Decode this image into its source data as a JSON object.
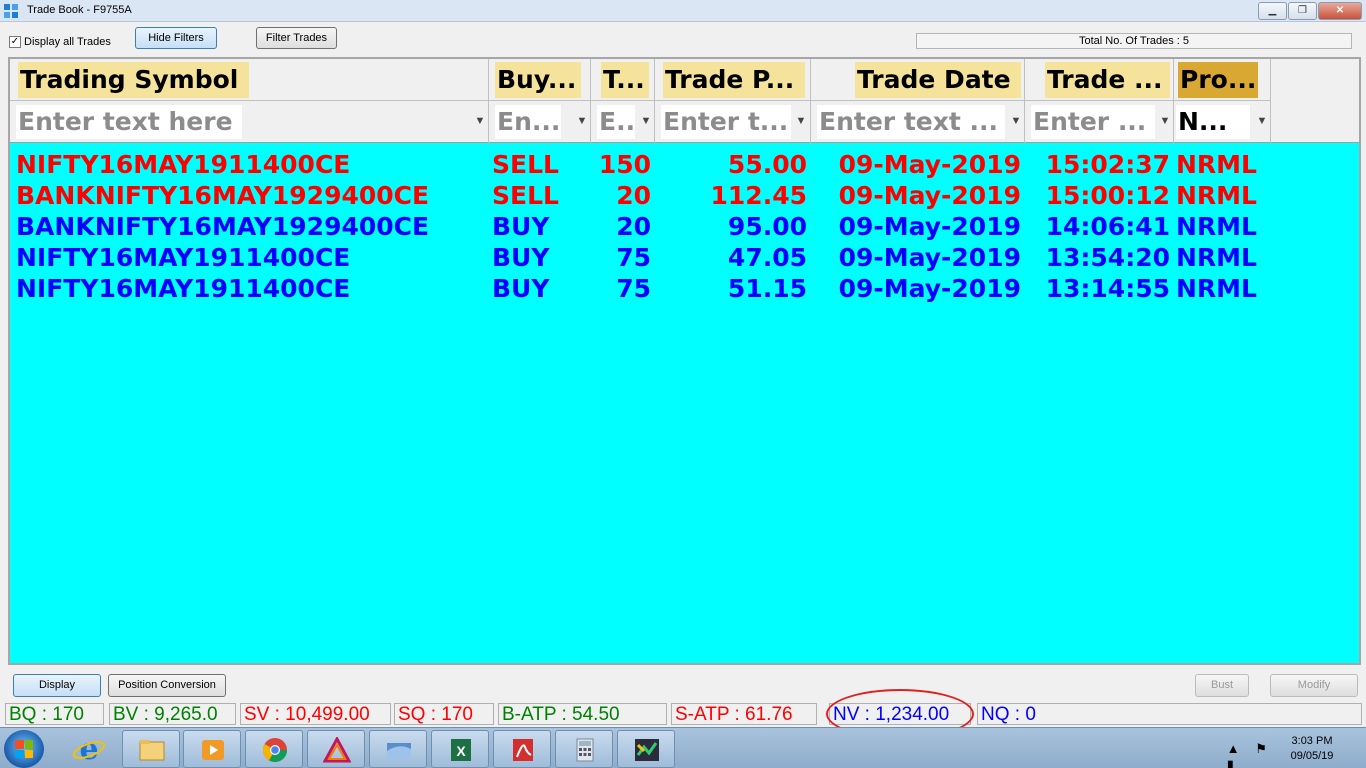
{
  "window": {
    "title": "Trade Book - F9755A",
    "min": "▁",
    "max": "❐",
    "close": "✕"
  },
  "toolbar": {
    "display_all_label": "Display all Trades",
    "display_all_checked": true,
    "hide_filters": "Hide Filters",
    "filter_trades": "Filter Trades",
    "total_trades": "Total No. Of Trades : 5"
  },
  "columns": [
    {
      "header": "Trading Symbol",
      "filter": "Enter text here"
    },
    {
      "header": "Buy...",
      "filter": "En..."
    },
    {
      "header": "T...",
      "filter": "E.."
    },
    {
      "header": "Trade P...",
      "filter": "Enter t..."
    },
    {
      "header": "Trade Date",
      "filter": "Enter text ..."
    },
    {
      "header": "Trade ...",
      "filter": "Enter ..."
    },
    {
      "header": "Pro...",
      "filter": "N..."
    }
  ],
  "trades": [
    {
      "symbol": "NIFTY16MAY1911400CE",
      "side": "SELL",
      "qty": "150",
      "price": "55.00",
      "date": "09-May-2019",
      "time": "15:02:37",
      "product": "NRML",
      "color": "#ff0000"
    },
    {
      "symbol": "BANKNIFTY16MAY1929400CE",
      "side": "SELL",
      "qty": "20",
      "price": "112.45",
      "date": "09-May-2019",
      "time": "15:00:12",
      "product": "NRML",
      "color": "#ff0000"
    },
    {
      "symbol": "BANKNIFTY16MAY1929400CE",
      "side": "BUY",
      "qty": "20",
      "price": "95.00",
      "date": "09-May-2019",
      "time": "14:06:41",
      "product": "NRML",
      "color": "#0000ff"
    },
    {
      "symbol": "NIFTY16MAY1911400CE",
      "side": "BUY",
      "qty": "75",
      "price": "47.05",
      "date": "09-May-2019",
      "time": "13:54:20",
      "product": "NRML",
      "color": "#0000ff"
    },
    {
      "symbol": "NIFTY16MAY1911400CE",
      "side": "BUY",
      "qty": "75",
      "price": "51.15",
      "date": "09-May-2019",
      "time": "13:14:55",
      "product": "NRML",
      "color": "#0000ff"
    }
  ],
  "actions": {
    "display": "Display",
    "position_conversion": "Position Conversion",
    "bust": "Bust",
    "modify": "Modify"
  },
  "status": {
    "bq": "BQ : 170",
    "bv": "BV : 9,265.0",
    "sv": "SV : 10,499.00",
    "sq": "SQ : 170",
    "batp": "B-ATP : 54.50",
    "satp": "S-ATP : 61.76",
    "nv": "NV : 1,234.00",
    "nq": "NQ : 0"
  },
  "colors": {
    "grid_bg": "#00ffff",
    "sell": "#ff0000",
    "buy": "#0000ff",
    "status_green": "#008000",
    "status_red": "#ff0000",
    "status_blue": "#0000ff",
    "annotation": "#e02020"
  },
  "taskbar": {
    "apps": [
      "ie-icon",
      "explorer-icon",
      "media-player-icon",
      "chrome-icon",
      "triangle-app-icon",
      "folder-app-icon",
      "excel-icon",
      "acrobat-icon",
      "calculator-icon",
      "trading-app-icon"
    ],
    "time": "3:03 PM",
    "date": "09/05/19"
  }
}
